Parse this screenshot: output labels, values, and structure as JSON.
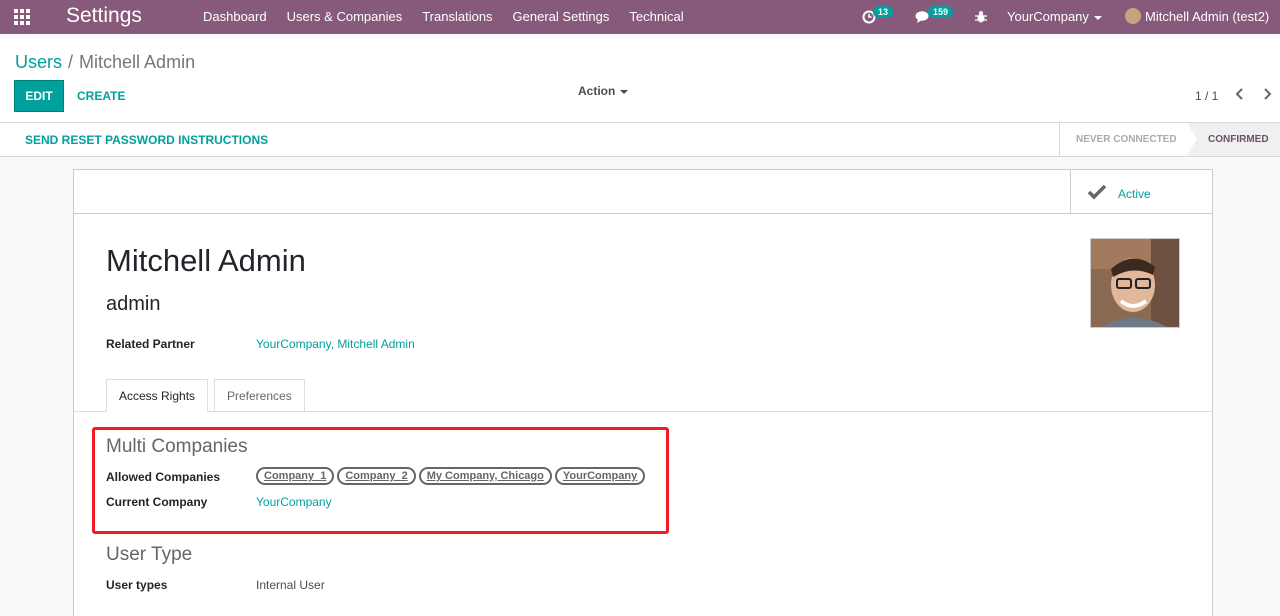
{
  "navbar": {
    "app_title": "Settings",
    "menu": [
      "Dashboard",
      "Users & Companies",
      "Translations",
      "General Settings",
      "Technical"
    ],
    "activity_count": "13",
    "message_count": "159",
    "company": "YourCompany",
    "user": "Mitchell Admin (test2)",
    "bg_color": "#875a7b"
  },
  "control": {
    "breadcrumb_parent": "Users",
    "breadcrumb_separator": "/",
    "breadcrumb_current": "Mitchell Admin",
    "edit_label": "EDIT",
    "create_label": "CREATE",
    "action_label": "Action",
    "pager": "1 / 1"
  },
  "statusbar": {
    "reset_label": "SEND RESET PASSWORD INSTRUCTIONS",
    "stages": [
      "NEVER CONNECTED",
      "CONFIRMED"
    ],
    "current_stage": "CONFIRMED"
  },
  "form": {
    "active_label": "Active",
    "name": "Mitchell Admin",
    "login": "admin",
    "related_partner_label": "Related Partner",
    "related_partner_value": "YourCompany, Mitchell Admin",
    "tabs": [
      "Access Rights",
      "Preferences"
    ],
    "multi_companies": {
      "title": "Multi Companies",
      "allowed_label": "Allowed Companies",
      "allowed": [
        "Company_1",
        "Company_2",
        "My Company, Chicago",
        "YourCompany"
      ],
      "current_label": "Current Company",
      "current_value": "YourCompany"
    },
    "user_type": {
      "title": "User Type",
      "label": "User types",
      "value": "Internal User"
    }
  },
  "colors": {
    "accent": "#00a09d",
    "highlight": "#ef1c24"
  }
}
